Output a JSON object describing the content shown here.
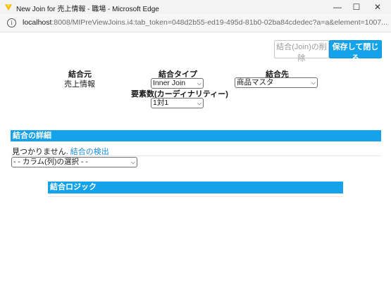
{
  "window": {
    "title": "New Join for 売上情報 - 職場 - Microsoft Edge",
    "minimize_glyph": "—",
    "maximize_glyph": "☐",
    "close_glyph": "✕"
  },
  "address": {
    "info_glyph": "i",
    "host": "localhost",
    "path": ":8008/MIPreViewJoins.i4:tab_token=048d2b55-ed19-495d-81b0-02ba84cdedec?a=a&element=1007..."
  },
  "toolbar": {
    "delete_label": "結合(Join)の削除",
    "save_close_label": "保存して閉じる"
  },
  "join": {
    "source_label": "結合元",
    "source_value": "売上情報",
    "type_label": "結合タイプ",
    "type_value": "Inner Join",
    "cardinality_label": "要素数(カーディナリティー)",
    "cardinality_value": "1対1",
    "target_label": "結合先",
    "target_value": "商品マスタ"
  },
  "details": {
    "header": "結合の詳細",
    "not_found": "見つかりません.",
    "detect_link": "結合の検出",
    "column_select": "- - カラム(列)の選択 - -"
  },
  "logic": {
    "header": "結合ロジック"
  },
  "icons": {
    "app": "edge-app-icon",
    "dropdown": "chevron-down-icon"
  },
  "colors": {
    "accent": "#14a3ea",
    "link": "#1a8bd6",
    "titlebar": "#f3f3f3"
  }
}
